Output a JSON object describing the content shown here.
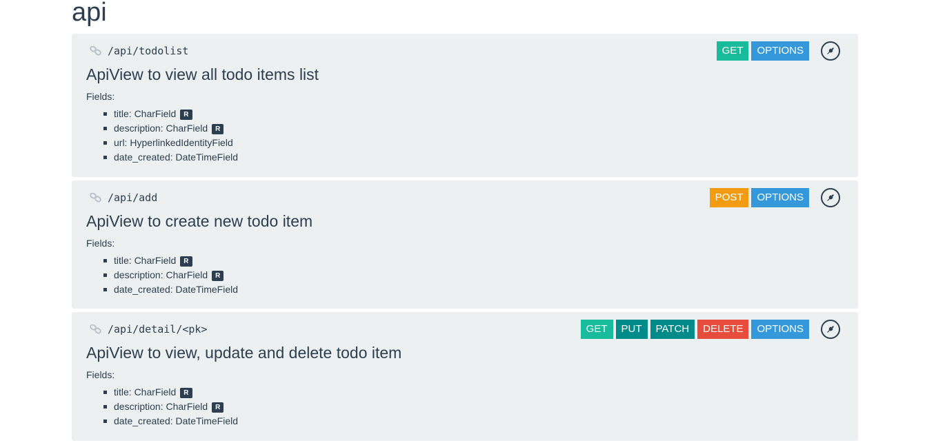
{
  "page": {
    "title": "api"
  },
  "colors": {
    "GET": "#18bc9c",
    "POST": "#f39c12",
    "PUT": "#008b8b",
    "PATCH": "#008b8b",
    "DELETE": "#e74c3c",
    "OPTIONS": "#3498db",
    "text": "#2c3e50",
    "panel_bg": "#ecf0f1"
  },
  "endpoints": [
    {
      "path": "/api/todolist",
      "description": "ApiView to view all todo items list",
      "fields_label": "Fields:",
      "methods": [
        "GET",
        "OPTIONS"
      ],
      "fields": [
        {
          "text": "title: CharField",
          "badge": "R"
        },
        {
          "text": "description: CharField",
          "badge": "R"
        },
        {
          "text": "url: HyperlinkedIdentityField",
          "badge": ""
        },
        {
          "text": "date_created: DateTimeField",
          "badge": ""
        }
      ],
      "icon": "plug-icon"
    },
    {
      "path": "/api/add",
      "description": "ApiView to create new todo item",
      "fields_label": "Fields:",
      "methods": [
        "POST",
        "OPTIONS"
      ],
      "fields": [
        {
          "text": "title: CharField",
          "badge": "R"
        },
        {
          "text": "description: CharField",
          "badge": "R"
        },
        {
          "text": "date_created: DateTimeField",
          "badge": ""
        }
      ],
      "icon": "plug-icon"
    },
    {
      "path": "/api/detail/<pk>",
      "description": "ApiView to view, update and delete todo item",
      "fields_label": "Fields:",
      "methods": [
        "GET",
        "PUT",
        "PATCH",
        "DELETE",
        "OPTIONS"
      ],
      "fields": [
        {
          "text": "title: CharField",
          "badge": "R"
        },
        {
          "text": "description: CharField",
          "badge": "R"
        },
        {
          "text": "date_created: DateTimeField",
          "badge": ""
        }
      ],
      "icon": "plug-icon"
    }
  ]
}
